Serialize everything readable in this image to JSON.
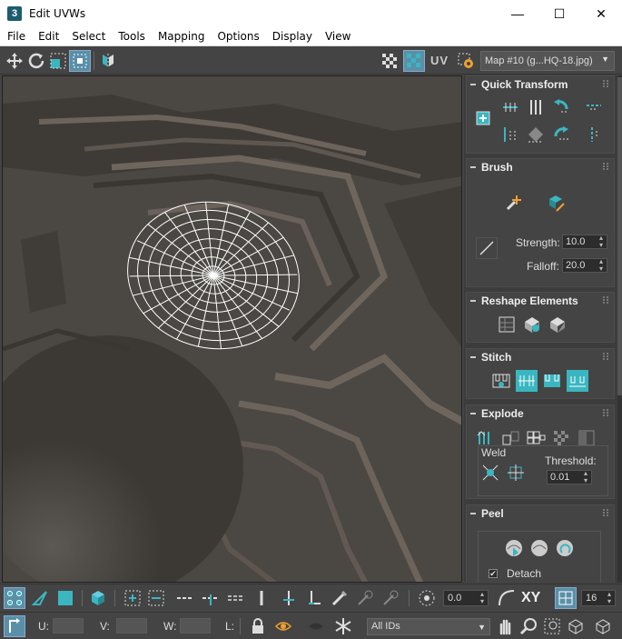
{
  "window": {
    "app_icon_text": "3",
    "title": "Edit UVWs",
    "minimize": "—",
    "maximize": "☐",
    "close": "✕"
  },
  "menu": [
    "File",
    "Edit",
    "Select",
    "Tools",
    "Mapping",
    "Options",
    "Display",
    "View"
  ],
  "toolbar": {
    "uv_label": "UV",
    "map_select": "Map #10 (g...HQ-18.jpg)"
  },
  "rollouts": {
    "quick_transform": {
      "title": "Quick Transform"
    },
    "brush": {
      "title": "Brush",
      "strength_label": "Strength:",
      "strength_value": "10.0",
      "falloff_label": "Falloff:",
      "falloff_value": "20.0"
    },
    "reshape": {
      "title": "Reshape Elements"
    },
    "stitch": {
      "title": "Stitch"
    },
    "explode": {
      "title": "Explode",
      "weld_label": "Weld",
      "threshold_label": "Threshold:",
      "threshold_value": "0.01"
    },
    "peel": {
      "title": "Peel",
      "detach_label": "Detach",
      "detach_checked": true
    }
  },
  "bottom": {
    "rotation_value": "0.0",
    "xy_label": "XY",
    "grid_value": "16",
    "u_label": "U:",
    "v_label": "V:",
    "w_label": "W:",
    "l_label": "L:",
    "ids_select": "All IDs"
  },
  "colors": {
    "accent": "#5b8fa8",
    "teal_icon": "#3ab6c0",
    "orange_icon": "#f0a030",
    "panel_bg": "#444444",
    "viewport_bg": "#4a4642"
  }
}
